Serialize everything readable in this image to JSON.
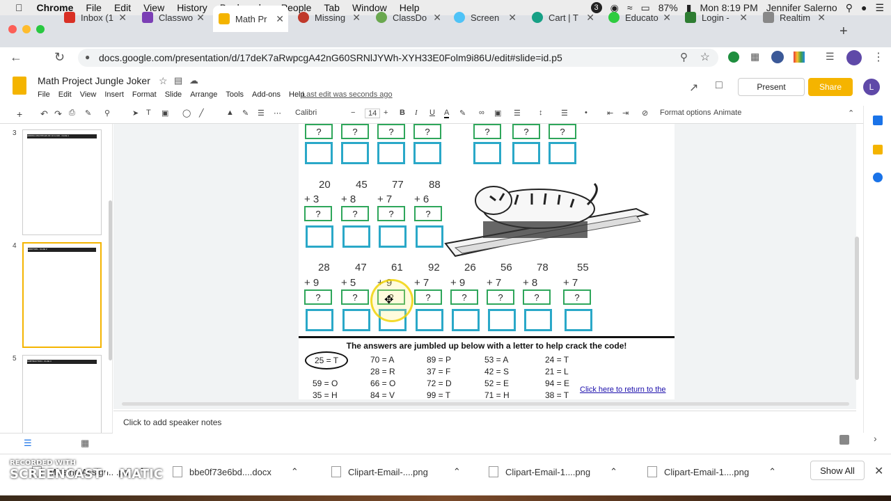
{
  "menubar": {
    "app": "Chrome",
    "items": [
      "File",
      "Edit",
      "View",
      "History",
      "Bookmarks",
      "People",
      "Tab",
      "Window",
      "Help"
    ],
    "battery": "87%",
    "clock": "Mon 8:19 PM",
    "user": "Jennifer Salerno",
    "badge": "3"
  },
  "tabs": [
    {
      "label": "Inbox (1",
      "color": "#d93025"
    },
    {
      "label": "Classwo",
      "color": "#7b3fb5"
    },
    {
      "label": "Math Pr",
      "color": "#f4b400"
    },
    {
      "label": "Missing",
      "color": "#c0392b"
    },
    {
      "label": "ClassDo",
      "color": "#6aa84f"
    },
    {
      "label": "Screen",
      "color": "#4fc3f7"
    },
    {
      "label": "Cart | T",
      "color": "#16a085"
    },
    {
      "label": "Educato",
      "color": "#2ecc40"
    },
    {
      "label": "Login -",
      "color": "#2e7d32"
    },
    {
      "label": "Realtim",
      "color": "#888888"
    }
  ],
  "url": "docs.google.com/presentation/d/17deK7aRwpcgA42nG60SRNlJYWh-XYH33E0Folm9i86U/edit#slide=id.p5",
  "doc": {
    "title": "Math Project Jungle Joker",
    "menus": [
      "File",
      "Edit",
      "View",
      "Insert",
      "Format",
      "Slide",
      "Arrange",
      "Tools",
      "Add-ons",
      "Help"
    ],
    "last_edit": "Last edit was seconds ago",
    "present": "Present",
    "share": "Share",
    "avatar": "L"
  },
  "toolbar": {
    "font": "Calibri",
    "size": "14",
    "format_options": "Format options",
    "animate": "Animate"
  },
  "filmstrip": [
    {
      "num": "3",
      "title": "ADDING MULTIPLES OF 10 & 100 - CLUE 1"
    },
    {
      "num": "4",
      "title": "ADDITION - CLUE 2"
    },
    {
      "num": "5",
      "title": "SUBTRACTION - CLUE 3"
    }
  ],
  "slide": {
    "q_mark": "?",
    "row2": [
      {
        "a": "20",
        "b": "+ 3"
      },
      {
        "a": "45",
        "b": "+ 8"
      },
      {
        "a": "77",
        "b": "+ 7"
      },
      {
        "a": "88",
        "b": "+ 6"
      }
    ],
    "row3": [
      {
        "a": "28",
        "b": "+ 9"
      },
      {
        "a": "47",
        "b": "+ 5"
      },
      {
        "a": "61",
        "b": "+ 9"
      },
      {
        "a": "92",
        "b": "+ 7"
      },
      {
        "a": "26",
        "b": "+ 9"
      },
      {
        "a": "56",
        "b": "+ 7"
      },
      {
        "a": "78",
        "b": "+ 8"
      },
      {
        "a": "55",
        "b": "+ 7"
      }
    ],
    "answers_heading": "The answers are jumbled up below with a letter to help crack the code!",
    "key": [
      [
        "25 = T",
        "59 = O",
        "35 = H"
      ],
      [
        "70 = A",
        "28 = R",
        "66 = O",
        "84 = V"
      ],
      [
        "89 = P",
        "37 = F",
        "72 = D",
        "99 = T"
      ],
      [
        "53 = A",
        "42 = S",
        "52 = E",
        "71 = H"
      ],
      [
        "24 = T",
        "21 = L",
        "94 = E",
        "38 = T"
      ]
    ],
    "link": "Click here to return to the"
  },
  "notes": "Click to add speaker notes",
  "downloads": [
    {
      "name": "Missing Assign....pdf"
    },
    {
      "name": "bbe0f73e6bd....docx"
    },
    {
      "name": "Clipart-Email-....png"
    },
    {
      "name": "Clipart-Email-1....png"
    },
    {
      "name": "Clipart-Email-1....png"
    }
  ],
  "show_all": "Show All",
  "watermark": {
    "line1": "RECORDED WITH",
    "line2": "SCREENCAST",
    "line3": "MATIC"
  }
}
